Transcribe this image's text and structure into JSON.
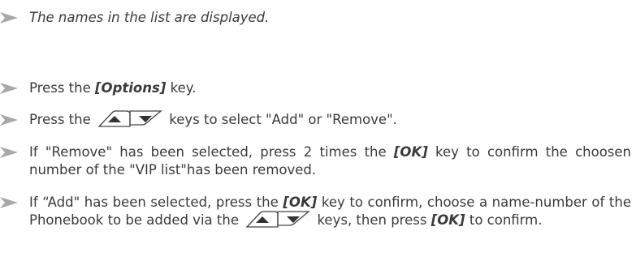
{
  "colors": {
    "arrow": "#a8a8a8",
    "text": "#3a3a3a"
  },
  "intro": {
    "text": "The names in the list are displayed."
  },
  "step1": {
    "before": "Press the ",
    "key": "[Options]",
    "after": " key."
  },
  "step2": {
    "before": "Press the ",
    "keys_icon": "up-down-arrow-keys",
    "after": " keys to select  \"Add\" or \"Remove\"."
  },
  "step3": {
    "before": "If \"Remove\" has been selected, press 2 times the ",
    "key": "[OK]",
    "after": " key to confirm the choosen number of the \"VIP list\"has been removed."
  },
  "step4": {
    "part1": "If “Add\" has been selected, press the ",
    "key1": "[OK]",
    "part2": " key to confirm, choose a name-number of the Phonebook to be added via the ",
    "keys_icon": "up-down-arrow-keys",
    "part3": " keys, then press ",
    "key2": "[OK]",
    "part4": " to confirm."
  }
}
